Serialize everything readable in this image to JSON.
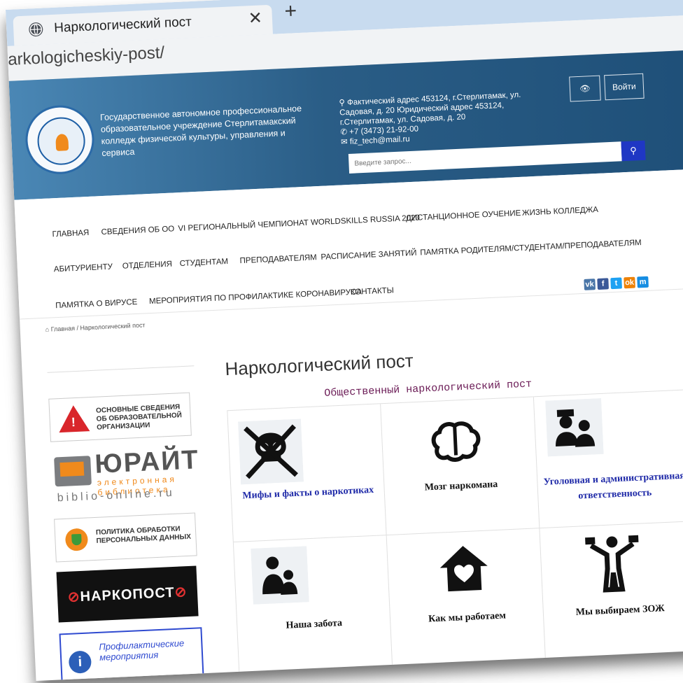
{
  "browser": {
    "tab_title": "Наркологический пост",
    "close_label": "✕",
    "new_tab_label": "+",
    "url": "arkologicheskiy-post/"
  },
  "header": {
    "org_name": "Государственное автономное профессиональное образовательное учреждение Стерлитамакский колледж физической культуры, управления и сервиса",
    "address": "Фактический адрес 453124, г.Стерлитамак, ул. Садовая, д. 20 Юридический адрес 453124, г.Стерлитамак, ул. Садовая, д. 20",
    "phone": "+7 (3473) 21-92-00",
    "email": "fiz_tech@mail.ru",
    "login_label": "Войти",
    "eye_label": "👁",
    "search_placeholder": "Введите запрос..."
  },
  "nav": {
    "row1": [
      "ГЛАВНАЯ",
      "СВЕДЕНИЯ ОБ ОО",
      "VI РЕГИОНАЛЬНЫЙ ЧЕМПИОНАТ WORLDSKILLS RUSSIA 2020",
      "ДИСТАНЦИОННОЕ ОУЧЕНИЕ",
      "ЖИЗНЬ КОЛЛЕДЖА"
    ],
    "row2": [
      "АБИТУРИЕНТУ",
      "ОТДЕЛЕНИЯ",
      "СТУДЕНТАМ",
      "ПРЕПОДАВАТЕЛЯМ",
      "РАСПИСАНИЕ ЗАНЯТИЙ",
      "ПАМЯТКА РОДИТЕЛЯМ/СТУДЕНТАМ/ПРЕПОДАВАТЕЛЯМ"
    ],
    "row3": [
      "ПАМЯТКА О ВИРУСЕ",
      "МЕРОПРИЯТИЯ ПО ПРОФИЛАКТИКЕ КОРОНАВИРУСА",
      "КОНТАКТЫ"
    ],
    "social": [
      {
        "label": "vk",
        "color": "#4a76a8"
      },
      {
        "label": "f",
        "color": "#3b5998"
      },
      {
        "label": "t",
        "color": "#1da1f2"
      },
      {
        "label": "ok",
        "color": "#ee8208"
      },
      {
        "label": "m",
        "color": "#168de2"
      }
    ]
  },
  "breadcrumb": "Главная / Наркологический пост",
  "sidebar": {
    "warning_text": "ОСНОВНЫЕ СВЕДЕНИЯ ОБ ОБРАЗОВАТЕЛЬНОЙ ОРГАНИЗАЦИИ",
    "yurait_title": "ЮРАЙТ",
    "yurait_sub": "электронная библиотека",
    "yurait_url": "biblio-online.ru",
    "policy_text": "ПОЛИТИКА ОБРАБОТКИ ПЕРСОНАЛЬНЫХ ДАННЫХ",
    "narko_text": "НАРКОПОСТ",
    "profil_text": "Профилактические мероприятия"
  },
  "main": {
    "title": "Наркологический пост",
    "subtitle": "Общественный наркологический пост",
    "cards": [
      {
        "label": "Мифы и факты о наркотиках",
        "icon": "skull-crossbones-icon"
      },
      {
        "label": "Мозг наркомана",
        "icon": "brain-icon"
      },
      {
        "label": "Уголовная и административная ответственность",
        "icon": "police-family-icon"
      },
      {
        "label": "Наша забота",
        "icon": "parent-child-icon"
      },
      {
        "label": "Как мы работаем",
        "icon": "house-heart-icon"
      },
      {
        "label": "Мы выбираем ЗОЖ",
        "icon": "athlete-dumbbells-icon"
      }
    ]
  }
}
